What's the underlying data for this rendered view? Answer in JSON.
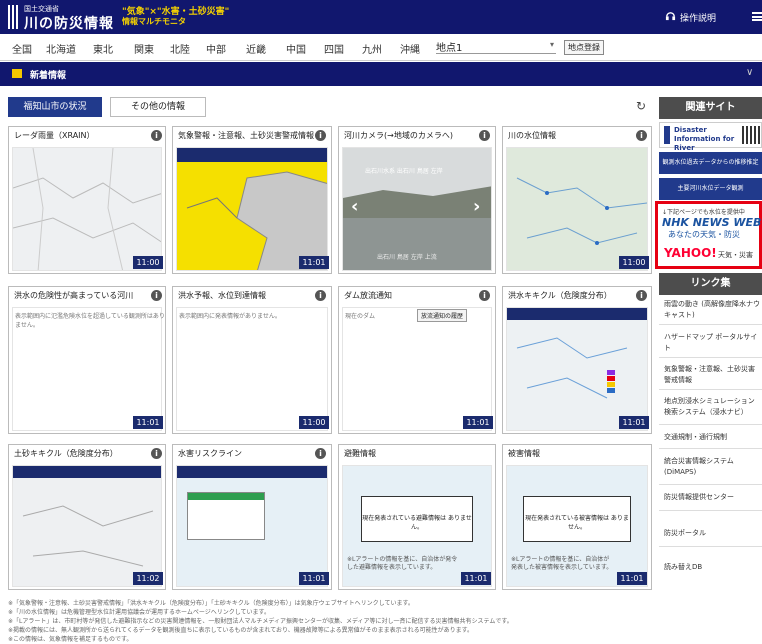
{
  "header": {
    "ministry": "国土交通省",
    "title": "川の防災情報",
    "tagline1": "\"気象\"×\"水害・土砂災害\"",
    "tagline2": "情報マルチモニタ",
    "help": "操作説明"
  },
  "regions": [
    "全国",
    "北海道",
    "東北",
    "関東",
    "北陸",
    "中部",
    "近畿",
    "中国",
    "四国",
    "九州",
    "沖縄"
  ],
  "place": {
    "value": "地点1",
    "register": "地点登録"
  },
  "news": {
    "label": "新着情報"
  },
  "tabs": {
    "active": "福知山市の状況",
    "other": "その他の情報"
  },
  "panels": [
    {
      "title": "レーダ雨量（XRAIN）",
      "time": "11:00"
    },
    {
      "title": "気象警報・注意報、土砂災害警戒情報",
      "time": "11:01"
    },
    {
      "title": "河川カメラ(→地域のカメラへ)",
      "time": ""
    },
    {
      "title": "川の水位情報",
      "time": "11:00"
    },
    {
      "title": "洪水の危険性が高まっている河川",
      "time": "11:01",
      "msg": "表示範囲内に氾濫危険水位を超過している観測所はありません。"
    },
    {
      "title": "洪水予報、水位到達情報",
      "time": "11:00",
      "msg": "表示範囲内に発表情報がありません。"
    },
    {
      "title": "ダム放流通知",
      "time": "11:01",
      "msg": "現在のダム",
      "btn": "放流通知の履歴"
    },
    {
      "title": "洪水キキクル（危険度分布）",
      "time": "11:01"
    },
    {
      "title": "土砂キキクル（危険度分布）",
      "time": "11:02"
    },
    {
      "title": "水害リスクライン",
      "time": "11:01"
    },
    {
      "title": "避難情報",
      "time": "11:01",
      "msg": "現在発表されている避難情報は ありません。",
      "note": "※Lアラートの情報を基に、自治体が発令した避難情報を表示しています。"
    },
    {
      "title": "被害情報",
      "time": "11:01",
      "msg": "現在発表されている被害情報は ありません。",
      "note": "※Lアラートの情報を基に、自治体が発表した被害情報を表示しています。"
    }
  ],
  "camera": {
    "caption": "出石川水系 出石川 鳥居 左岸",
    "sub": "出石川 鳥居 左岸 上流"
  },
  "sidebar": {
    "related_heading": "関連サイト",
    "disaster_info": "Disaster Information for River",
    "btn1": "観測水位過去データからの推移推定",
    "btn2": "主要河川水位データ観測",
    "notice": "↓下記ページでも水位を提供中",
    "nhk": "NHK NEWS WEB",
    "nhk_sub": "あなたの天気・防災",
    "yahoo": "YAHOO!",
    "yahoo_sub": "天気・災害",
    "links_heading": "リンク集",
    "links": [
      "雨雲の動き (高解像度降水ナウキャスト)",
      "ハザードマップ ポータルサイト",
      "気象警報・注意報、土砂災害警戒情報",
      "地点別浸水シミュレーション検索システム（浸水ナビ）",
      "交通規制・通行規制",
      "統合災害情報システム (DiMAPS)",
      "防災情報提供センター",
      "防災ポータル",
      "読み替えDB"
    ]
  },
  "footer": [
    "※「気象警報・注意報、土砂災害警戒情報」「洪水キキクル（危険度分布）」「土砂キキクル（危険度分布）」は気象庁ウェブサイトへリンクしています。",
    "※「川の水位情報」は危機管理型水位計運用協議会が運用するホームページへリンクしています。",
    "※「Lアラート」は、市町村等が発信した避難指示などの災害関連情報を、一般財団法人マルチメディア振興センターが収集、メディア等に対し一斉に配信する災害情報共有システムです。",
    "※掲載の情報には、無人観測所から送られてくるデータを観測後直ちに表示しているものが含まれており、機器故障等による異常値がそのまま表示される可能性があります。",
    "※この情報は、気象情報を補足するものです。"
  ],
  "colors": {
    "navy": "#11176e",
    "active": "#213a8c",
    "alert": "#e60012",
    "warning": "#f5e000"
  }
}
